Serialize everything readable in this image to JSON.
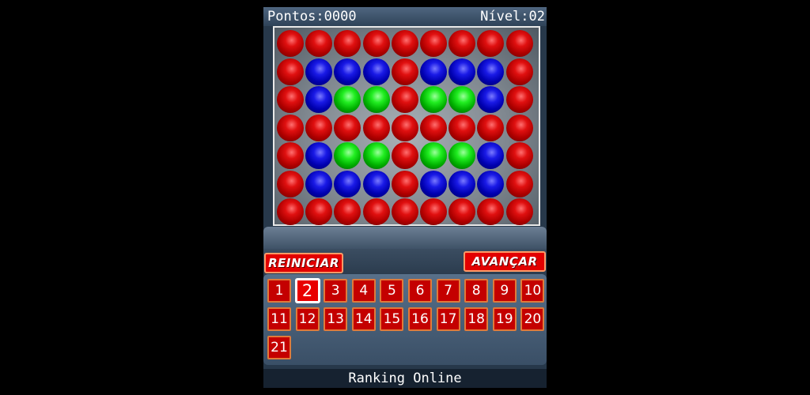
{
  "hud": {
    "score": "Pontos:0000",
    "level": "Nível:02"
  },
  "board": {
    "rows": [
      [
        "red",
        "red",
        "red",
        "red",
        "red",
        "red",
        "red",
        "red",
        "red"
      ],
      [
        "red",
        "blue",
        "blue",
        "blue",
        "red",
        "blue",
        "blue",
        "blue",
        "red"
      ],
      [
        "red",
        "blue",
        "green",
        "green",
        "red",
        "green",
        "green",
        "blue",
        "red"
      ],
      [
        "red",
        "red",
        "red",
        "red",
        "red",
        "red",
        "red",
        "red",
        "red"
      ],
      [
        "red",
        "blue",
        "green",
        "green",
        "red",
        "green",
        "green",
        "blue",
        "red"
      ],
      [
        "red",
        "blue",
        "blue",
        "blue",
        "red",
        "blue",
        "blue",
        "blue",
        "red"
      ],
      [
        "red",
        "red",
        "red",
        "red",
        "red",
        "red",
        "red",
        "red",
        "red"
      ]
    ]
  },
  "controls": {
    "restart_label": "REINICIAR",
    "next_label": "AVANÇAR"
  },
  "levels": {
    "current": 2,
    "items": [
      "1",
      "2",
      "3",
      "4",
      "5",
      "6",
      "7",
      "8",
      "9",
      "10",
      "11",
      "12",
      "13",
      "14",
      "15",
      "16",
      "17",
      "18",
      "19",
      "20",
      "21"
    ]
  },
  "footer": {
    "ranking_label": "Ranking Online"
  },
  "colors": {
    "ball_red": "#d00000",
    "ball_blue": "#0000c8",
    "ball_green": "#00c800",
    "level_button": "#c40000",
    "panel": "#3a4f66"
  }
}
